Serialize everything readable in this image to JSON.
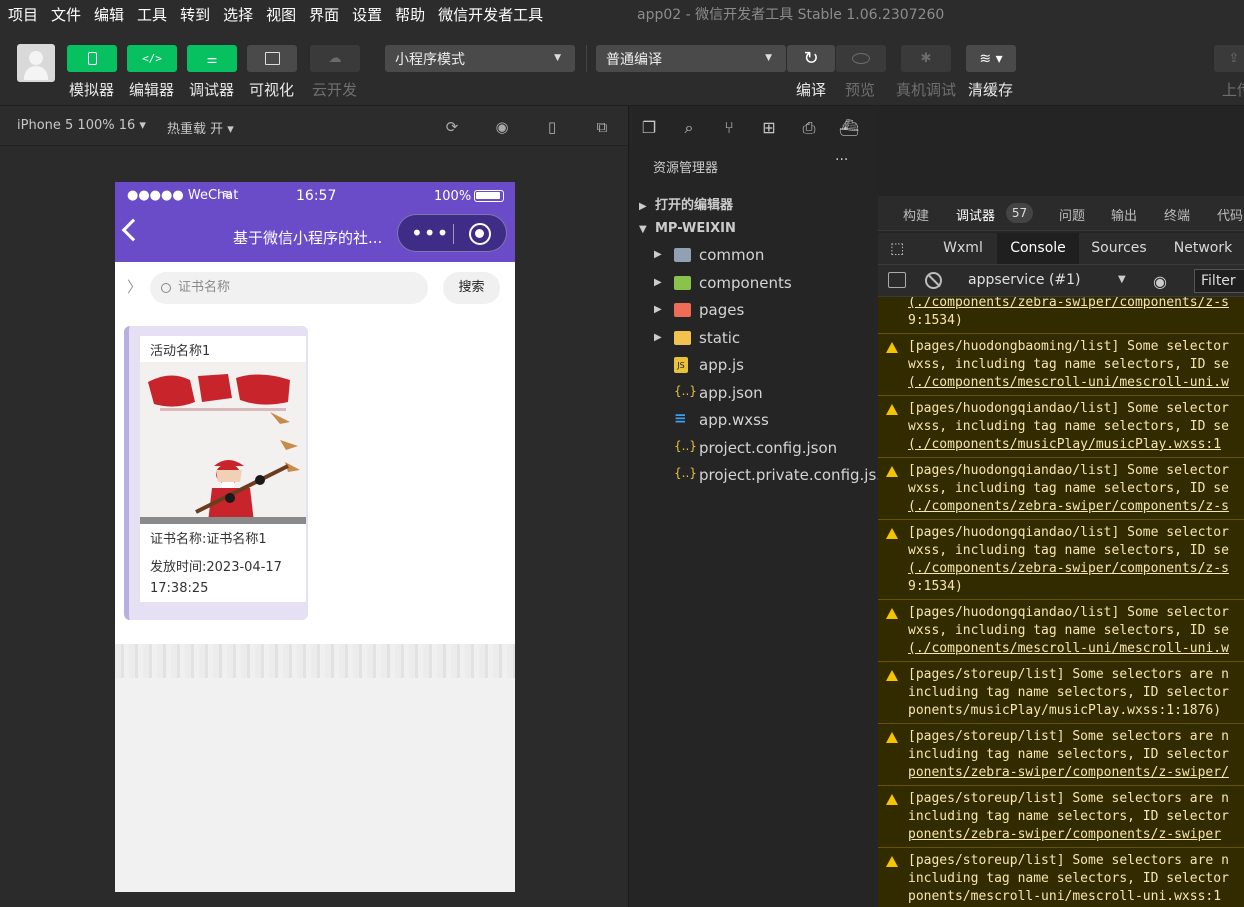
{
  "menu": [
    "项目",
    "文件",
    "编辑",
    "工具",
    "转到",
    "选择",
    "视图",
    "界面",
    "设置",
    "帮助",
    "微信开发者工具"
  ],
  "window_title": "app02 - 微信开发者工具 Stable 1.06.2307260",
  "toolbar": {
    "simulator": "模拟器",
    "editor": "编辑器",
    "debugger": "调试器",
    "visual": "可视化",
    "cloud": "云开发",
    "mode_select": "小程序模式",
    "compile_select": "普通编译",
    "compile": "编译",
    "preview": "预览",
    "real_debug": "真机调试",
    "clear_cache": "清缓存",
    "upload": "上传"
  },
  "simbar": {
    "device": "iPhone 5 100% 16 ▾",
    "hot_reload": "热重载 开 ▾"
  },
  "phone": {
    "carrier": "●●●●● WeChat",
    "time": "16:57",
    "battery": "100%",
    "page_title": "基于微信小程序的社...",
    "search_placeholder": "证书名称",
    "search_button": "搜索",
    "card": {
      "activity": "活动名称1",
      "cert": "证书名称:证书名称1",
      "issue_time_line1": "发放时间:2023-04-17",
      "issue_time_line2": "17:38:25"
    }
  },
  "explorer": {
    "header": "资源管理器",
    "open_editors": "打开的编辑器",
    "project": "MP-WEIXIN",
    "files": [
      {
        "name": "common",
        "type": "folder",
        "color": "#8fa1b3"
      },
      {
        "name": "components",
        "type": "folder",
        "color": "#8bc34a"
      },
      {
        "name": "pages",
        "type": "folder",
        "color": "#ef6c57"
      },
      {
        "name": "static",
        "type": "folder",
        "color": "#f2c14e"
      },
      {
        "name": "app.js",
        "type": "js",
        "color": "#e8c33a"
      },
      {
        "name": "app.json",
        "type": "json",
        "color": "#e8c33a"
      },
      {
        "name": "app.wxss",
        "type": "wxss",
        "color": "#3ba0f0"
      },
      {
        "name": "project.config.json",
        "type": "json",
        "color": "#e8c33a"
      },
      {
        "name": "project.private.config.js...",
        "type": "json",
        "color": "#e8c33a"
      }
    ]
  },
  "debugger": {
    "top_tabs": [
      "构建",
      "调试器",
      "问题",
      "输出",
      "终端",
      "代码"
    ],
    "badge": "57",
    "tabs": [
      "Wxml",
      "Console",
      "Sources",
      "Network"
    ],
    "context": "appservice (#1)",
    "filter_placeholder": "Filter",
    "messages": [
      [
        "(./components/zebra-swiper/components/z-s",
        "9:1534)"
      ],
      [
        "[pages/huodongbaoming/list] Some selector",
        "wxss, including tag name selectors, ID se",
        "(./components/mescroll-uni/mescroll-uni.w"
      ],
      [
        "[pages/huodongqiandao/list] Some selector",
        "wxss, including tag name selectors, ID se",
        "(./components/musicPlay/musicPlay.wxss:1"
      ],
      [
        "[pages/huodongqiandao/list] Some selector",
        "wxss, including tag name selectors, ID se",
        "(./components/zebra-swiper/components/z-s"
      ],
      [
        "[pages/huodongqiandao/list] Some selector",
        "wxss, including tag name selectors, ID se",
        "(./components/zebra-swiper/components/z-s",
        "9:1534)"
      ],
      [
        "[pages/huodongqiandao/list] Some selector",
        "wxss, including tag name selectors, ID se",
        "(./components/mescroll-uni/mescroll-uni.w"
      ],
      [
        "[pages/storeup/list] Some selectors are n",
        "including tag name selectors, ID selector",
        "ponents/musicPlay/musicPlay.wxss:1:1876)"
      ],
      [
        "[pages/storeup/list] Some selectors are n",
        "including tag name selectors, ID selector",
        "ponents/zebra-swiper/components/z-swiper/"
      ],
      [
        "[pages/storeup/list] Some selectors are n",
        "including tag name selectors, ID selector",
        "ponents/zebra-swiper/components/z-swiper"
      ],
      [
        "[pages/storeup/list] Some selectors are n",
        "including tag name selectors, ID selector",
        "ponents/mescroll-uni/mescroll-uni.wxss:1"
      ]
    ]
  }
}
